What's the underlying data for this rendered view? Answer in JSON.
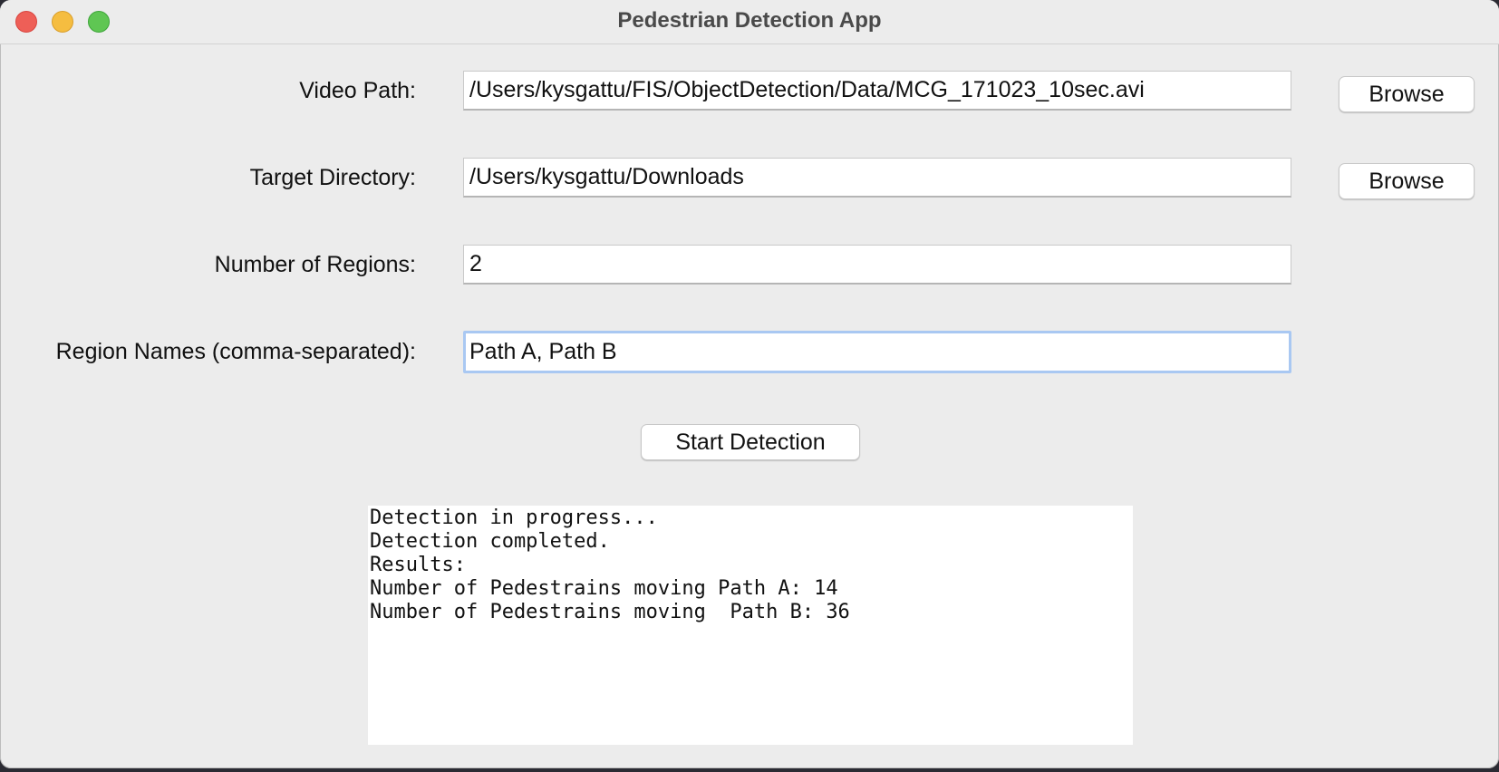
{
  "window": {
    "title": "Pedestrian Detection App"
  },
  "form": {
    "video_path": {
      "label": "Video Path:",
      "value": "/Users/kysgattu/FIS/ObjectDetection/Data/MCG_171023_10sec.avi",
      "browse_label": "Browse"
    },
    "target_directory": {
      "label": "Target Directory:",
      "value": "/Users/kysgattu/Downloads",
      "browse_label": "Browse"
    },
    "number_of_regions": {
      "label": "Number of Regions:",
      "value": "2"
    },
    "region_names": {
      "label": "Region Names (comma-separated):",
      "value": "Path A, Path B"
    }
  },
  "actions": {
    "start_label": "Start Detection"
  },
  "output": {
    "lines": [
      "Detection in progress...",
      "Detection completed.",
      "Results:",
      "Number of Pedestrains moving Path A: 14",
      "Number of Pedestrains moving  Path B: 36"
    ]
  },
  "colors": {
    "window_bg": "#ececec",
    "close": "#ee5f57",
    "minimize": "#f5bd40",
    "zoom": "#5fc653",
    "focus_ring": "#a9c8f2"
  }
}
